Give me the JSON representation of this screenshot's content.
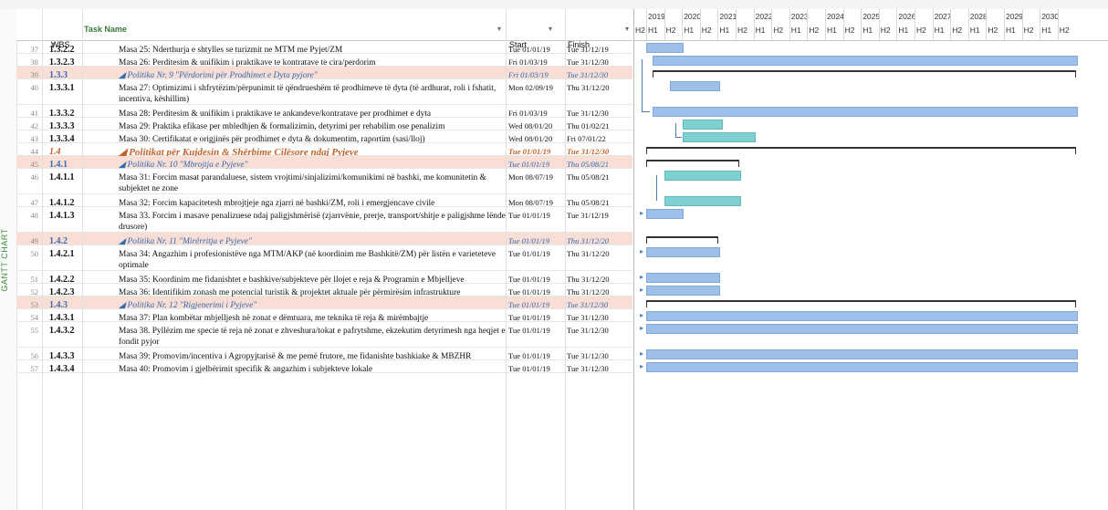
{
  "side_label": "GANTT CHART",
  "columns": {
    "wbs": "WBS",
    "task_name": "Task Name",
    "start": "Start",
    "finish": "Finish",
    "dropdown": "▾"
  },
  "timeline": {
    "years": [
      "2019",
      "2020",
      "2021",
      "2022",
      "2023",
      "2024",
      "2025",
      "2026",
      "2027",
      "2028",
      "2029",
      "2030"
    ],
    "lead_half": "H2",
    "half_labels": [
      "H1",
      "H2"
    ]
  },
  "rows": [
    {
      "id": "37",
      "wbs": "1.3.2.2",
      "name": "Masa 25: Nderthurja e shtylles se turizmit ne MTM me Pyjet/ZM",
      "start": "Tue 01/01/19",
      "finish": "Tue 31/12/19",
      "type": "task"
    },
    {
      "id": "38",
      "wbs": "1.3.2.3",
      "name": "Masa 26: Perditesim & unifikim i praktikave te kontratave te cira/perdorim",
      "start": "Fri 01/03/19",
      "finish": "Tue 31/12/30",
      "type": "task"
    },
    {
      "id": "39",
      "wbs": "1.3.3",
      "name": "◢ Politika Nr. 9 \"Përdorimi për Prodhimet e Dyta pyjore\"",
      "start": "Fri 01/03/19",
      "finish": "Tue 31/12/30",
      "type": "summary"
    },
    {
      "id": "40",
      "wbs": "1.3.3.1",
      "name": "Masa 27: Optimizimi i shfrytëzim/përpunimit të qëndrueshëm të prodhimeve të dyta (të ardhurat, roli i fshatit, incentiva, këshillim)",
      "start": "Mon 02/09/19",
      "finish": "Thu 31/12/20",
      "type": "task"
    },
    {
      "id": "41",
      "wbs": "1.3.3.2",
      "name": "Masa 28: Perditesim & unifikim i praktikave te ankandeve/kontratave per prodhimet e dyta",
      "start": "Fri 01/03/19",
      "finish": "Tue 31/12/30",
      "type": "task"
    },
    {
      "id": "42",
      "wbs": "1.3.3.3",
      "name": "Masa 29: Praktika efikase per mbledhjen & formalizimin, detyrimi per rehabilim ose penalizim",
      "start": "Wed 08/01/20",
      "finish": "Thu 01/02/21",
      "type": "task"
    },
    {
      "id": "43",
      "wbs": "1.3.3.4",
      "name": "Masa 30: Certifikatat e origjinës për prodhimet e dyta & dokumentim, raportim (sasi/lloj)",
      "start": "Wed 08/01/20",
      "finish": "Fri 07/01/22",
      "type": "task"
    },
    {
      "id": "44",
      "wbs": "1.4",
      "name": "◢ Politikat për Kujdesin & Shërbime Cilësore ndaj Pyjeve",
      "start": "Tue 01/01/19",
      "finish": "Tue 31/12/30",
      "type": "top"
    },
    {
      "id": "45",
      "wbs": "1.4.1",
      "name": "◢ Politika Nr. 10 \"Mbrojtja e Pyjeve\"",
      "start": "Tue 01/01/19",
      "finish": "Thu 05/08/21",
      "type": "summary"
    },
    {
      "id": "46",
      "wbs": "1.4.1.1",
      "name": "Masa 31: Forcim masat parandaluese, sistem vrojtimi/sinjalizimi/komunikimi në bashki, me komunitetin & subjektet ne zone",
      "start": "Mon 08/07/19",
      "finish": "Thu 05/08/21",
      "type": "task"
    },
    {
      "id": "47",
      "wbs": "1.4.1.2",
      "name": "Masa 32: Forcim kapacitetesh mbrojtjeje nga zjarri në bashki/ZM, roli i emergjencave civile",
      "start": "Mon 08/07/19",
      "finish": "Thu 05/08/21",
      "type": "task"
    },
    {
      "id": "48",
      "wbs": "1.4.1.3",
      "name": "Masa 33. Forcim i masave penalizuese ndaj paligjshmërisë (zjarrvënie, prerje, transport/shitje e paligjshme lënde drusore)",
      "start": "Tue 01/01/19",
      "finish": "Tue 31/12/19",
      "type": "task"
    },
    {
      "id": "49",
      "wbs": "1.4.2",
      "name": "◢ Politika Nr. 11 \"Mirërritja e Pyjeve\"",
      "start": "Tue 01/01/19",
      "finish": "Thu 31/12/20",
      "type": "summary"
    },
    {
      "id": "50",
      "wbs": "1.4.2.1",
      "name": "Masa 34: Angazhim i profesionistëve nga MTM/AKP (në koordinim me Bashkitë/ZM) për listën e varieteteve optimale",
      "start": "Tue 01/01/19",
      "finish": "Thu 31/12/20",
      "type": "task"
    },
    {
      "id": "51",
      "wbs": "1.4.2.2",
      "name": "Masa 35: Koordinim me fidanishtet e bashkive/subjekteve për llojet e reja & Programin e Mbjelljeve",
      "start": "Tue 01/01/19",
      "finish": "Thu 31/12/20",
      "type": "task"
    },
    {
      "id": "52",
      "wbs": "1.4.2.3",
      "name": "Masa 36: Identifikim zonash me potencial turistik & projektet aktuale për përmirësim infrastrukture",
      "start": "Tue 01/01/19",
      "finish": "Thu 31/12/20",
      "type": "task"
    },
    {
      "id": "53",
      "wbs": "1.4.3",
      "name": "◢ Politika Nr. 12 \"Rigjenerimi i Pyjeve\"",
      "start": "Tue 01/01/19",
      "finish": "Tue 31/12/30",
      "type": "summary"
    },
    {
      "id": "54",
      "wbs": "1.4.3.1",
      "name": "Masa 37: Plan kombëtar mbjelljesh në zonat e dëmtuara, me teknika të reja & mirëmbajtje",
      "start": "Tue 01/01/19",
      "finish": "Tue 31/12/30",
      "type": "task"
    },
    {
      "id": "55",
      "wbs": "1.4.3.2",
      "name": "Masa 38. Pyllëzim me specie të reja në zonat e zhveshura/tokat e pafrytshme, ekzekutim detyrimesh nga heqjet e fondit pyjor",
      "start": "Tue 01/01/19",
      "finish": "Tue 31/12/30",
      "type": "task"
    },
    {
      "id": "56",
      "wbs": "1.4.3.3",
      "name": "Masa 39: Promovim/incentiva i Agropyjtarisë & me pemë frutore, me fidanishte bashkiake & MBZHR",
      "start": "Tue 01/01/19",
      "finish": "Tue 31/12/30",
      "type": "task"
    },
    {
      "id": "57",
      "wbs": "1.4.3.4",
      "name": "Masa 40: Promovim i gjelbërimit specifik & angazhim i subjekteve lokale",
      "start": "Tue 01/01/19",
      "finish": "Tue 31/12/30",
      "type": "task"
    }
  ],
  "colors": {
    "summary_row": "#f9ded5",
    "bar": "#9ec0e8",
    "bar_critical": "#7fd0d0",
    "link": "#4a7dc0",
    "header_accent": "#3a7a3a"
  }
}
